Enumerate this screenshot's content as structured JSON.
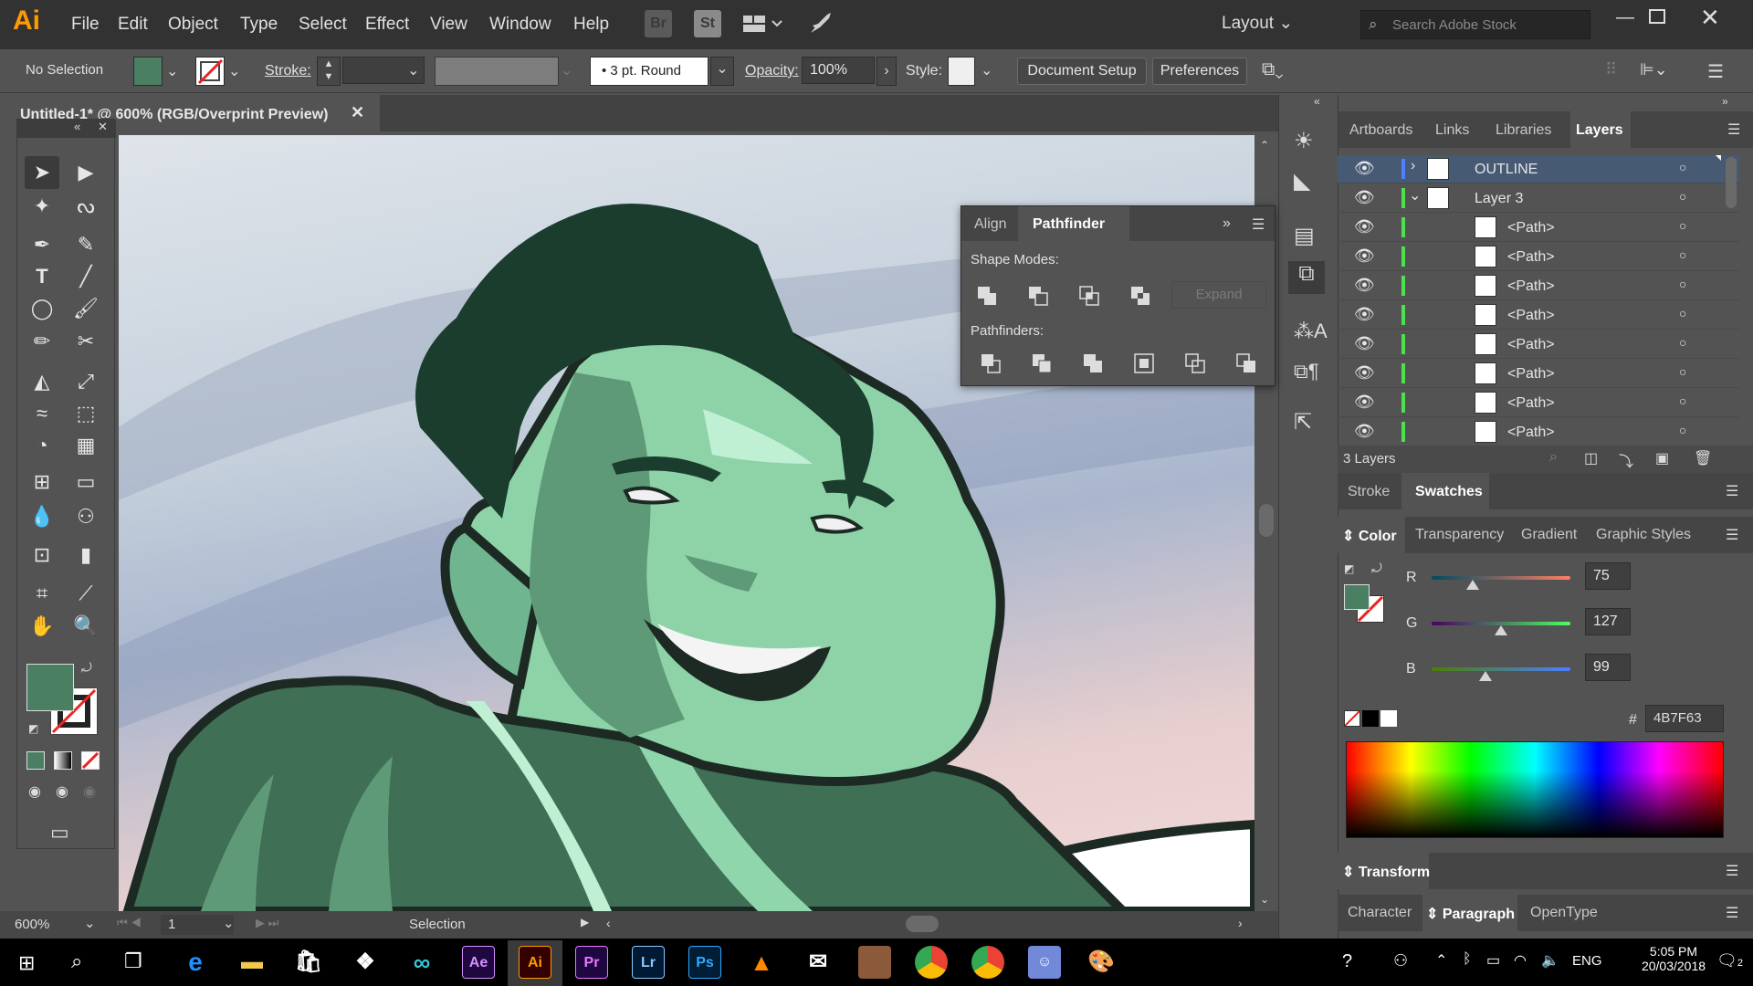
{
  "app": {
    "logo": "Ai",
    "menu": [
      "File",
      "Edit",
      "Object",
      "Type",
      "Select",
      "Effect",
      "View",
      "Window",
      "Help"
    ],
    "bridge_badges": [
      "Br",
      "St"
    ],
    "workspace": "Layout",
    "search_placeholder": "Search Adobe Stock"
  },
  "control_bar": {
    "selection_status": "No Selection",
    "stroke_label": "Stroke:",
    "brush": "3 pt. Round",
    "opacity_label": "Opacity:",
    "opacity_value": "100%",
    "style_label": "Style:",
    "document_setup": "Document Setup",
    "preferences": "Preferences"
  },
  "document": {
    "tab_title": "Untitled-1* @ 600% (RGB/Overprint Preview)",
    "zoom": "600%",
    "artboard": "1",
    "status_tool": "Selection"
  },
  "pathfinder_panel": {
    "tabs": [
      "Align",
      "Pathfinder"
    ],
    "active_tab": "Pathfinder",
    "shape_modes_label": "Shape Modes:",
    "expand_label": "Expand",
    "pathfinders_label": "Pathfinders:"
  },
  "layers_panel": {
    "tabs": [
      "Artboards",
      "Links",
      "Libraries",
      "Layers"
    ],
    "active_tab": "Layers",
    "rows": [
      {
        "name": "OUTLINE",
        "type": "layer",
        "color": "#4f7fff",
        "expanded": false,
        "selected": true
      },
      {
        "name": "Layer 3",
        "type": "layer",
        "color": "#4fe04f",
        "expanded": true,
        "selected": false
      },
      {
        "name": "<Path>",
        "type": "path",
        "color": "#4fe04f"
      },
      {
        "name": "<Path>",
        "type": "path",
        "color": "#4fe04f"
      },
      {
        "name": "<Path>",
        "type": "path",
        "color": "#4fe04f"
      },
      {
        "name": "<Path>",
        "type": "path",
        "color": "#4fe04f"
      },
      {
        "name": "<Path>",
        "type": "path",
        "color": "#4fe04f"
      },
      {
        "name": "<Path>",
        "type": "path",
        "color": "#4fe04f"
      },
      {
        "name": "<Path>",
        "type": "path",
        "color": "#4fe04f"
      },
      {
        "name": "<Path>",
        "type": "path",
        "color": "#4fe04f"
      }
    ],
    "count": "3 Layers"
  },
  "stroke_swatches": {
    "tabs": [
      "Stroke",
      "Swatches"
    ],
    "active_tab": "Swatches"
  },
  "color_panel": {
    "tabs": [
      "Color",
      "Transparency",
      "Gradient",
      "Graphic Styles"
    ],
    "active_tab": "Color",
    "r_label": "R",
    "r_value": "75",
    "r_level": 0.294,
    "g_label": "G",
    "g_value": "127",
    "g_level": 0.498,
    "b_label": "B",
    "b_value": "99",
    "b_level": 0.388,
    "hex_label": "#",
    "hex_value": "4B7F63",
    "fill_color": "#4b7f63"
  },
  "transform_panel": {
    "title": "Transform"
  },
  "type_panels": {
    "tabs": [
      "Character",
      "Paragraph",
      "OpenType"
    ],
    "active_tab": "Paragraph"
  },
  "taskbar": {
    "apps": [
      "edge",
      "file-explorer",
      "store",
      "dropbox",
      "infinity",
      "Ae",
      "Ai",
      "Pr",
      "Lr",
      "Ps",
      "vlc",
      "mail",
      "photo",
      "chrome",
      "chrome-profile",
      "discord-badge",
      "paint"
    ],
    "language": "ENG",
    "time": "5:05 PM",
    "date": "20/03/2018",
    "notification_count": "2"
  }
}
